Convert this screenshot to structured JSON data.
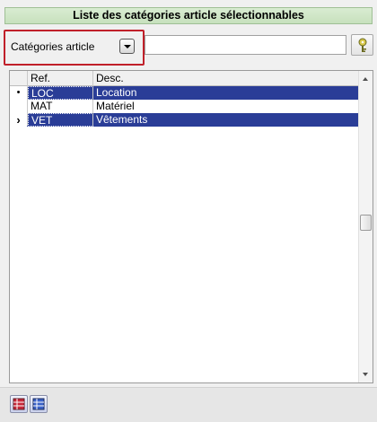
{
  "title": "Liste des catégories article sélectionnables",
  "category_combo": {
    "selected": "Catégories article"
  },
  "search": {
    "value": "",
    "placeholder": ""
  },
  "grid": {
    "columns": [
      "Ref.",
      "Desc."
    ],
    "rows": [
      {
        "indicator": "•",
        "ref": "LOC",
        "desc": "Location",
        "selected": true
      },
      {
        "indicator": "",
        "ref": "MAT",
        "desc": "Matériel",
        "selected": false
      },
      {
        "indicator": "›",
        "ref": "VET",
        "desc": "Vêtements",
        "selected": true
      }
    ]
  },
  "icons": {
    "search": "key-search-icon",
    "footer": [
      "table-red-icon",
      "table-blue-icon"
    ]
  },
  "colors": {
    "selection": "#2a3d97",
    "title_bar": "#c7e1bd",
    "highlight": "#c0202a"
  }
}
